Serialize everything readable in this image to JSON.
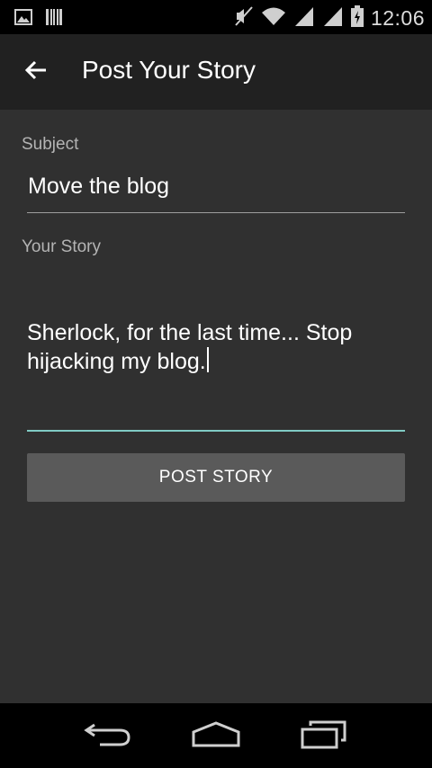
{
  "status_bar": {
    "time": "12:06",
    "icons": [
      "image-icon",
      "barcode-icon",
      "mute-icon",
      "wifi-icon",
      "signal-icon",
      "signal-icon",
      "battery-charging-icon"
    ]
  },
  "app_bar": {
    "title": "Post Your Story",
    "back_icon": "arrow-back-icon"
  },
  "form": {
    "subject_label": "Subject",
    "subject_value": "Move the blog",
    "story_label": "Your Story",
    "story_value": "Sherlock, for the last time... Stop hijacking my blog.",
    "post_button_label": "POST STORY",
    "focus_color": "#80cbc4"
  },
  "nav_bar": {
    "buttons": [
      "back-icon",
      "home-icon",
      "recents-icon"
    ]
  }
}
